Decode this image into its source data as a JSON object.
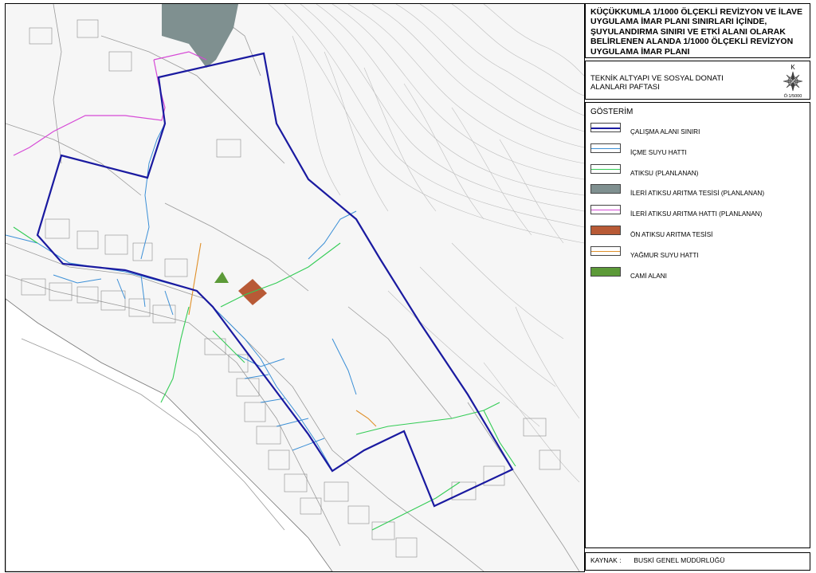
{
  "title": "KÜÇÜKKUMLA 1/1000 ÖLÇEKLİ REVİZYON VE İLAVE UYGULAMA İMAR PLANI SINIRLARI İÇİNDE, ŞUYULANDIRMA SINIRI VE ETKİ ALANI OLARAK BELİRLENEN ALANDA 1/1000 ÖLÇEKLİ REVİZYON UYGULAMA İMAR PLANI",
  "subtitle": "TEKNİK ALTYAPI VE SOSYAL DONATI ALANLARI PAFTASI",
  "compass": {
    "north": "K",
    "scale": "Ö:1/5000",
    "icon": "compass-rose-icon"
  },
  "legend": {
    "title": "GÖSTERİM",
    "items": [
      {
        "label": "ÇALIŞMA ALANI SINIRI",
        "kind": "line",
        "color": "#1a1aa0"
      },
      {
        "label": "İÇME SUYU HATTI",
        "kind": "line",
        "color": "#3b8fd6"
      },
      {
        "label": "ATIKSU (PLANLANAN)",
        "kind": "line",
        "color": "#33cc55"
      },
      {
        "label": "İLERİ ATIKSU ARITMA TESİSİ (PLANLANAN)",
        "kind": "fill",
        "color": "#7f9090"
      },
      {
        "label": "İLERİ ATIKSU ARITMA HATTI (PLANLANAN)",
        "kind": "line",
        "color": "#d64ad6"
      },
      {
        "label": "ÖN ATIKSU ARITMA TESİSİ",
        "kind": "fill",
        "color": "#b85a36"
      },
      {
        "label": "YAĞMUR SUYU HATTI",
        "kind": "line",
        "color": "#e0902a"
      },
      {
        "label": "CAMİ ALANI",
        "kind": "fill",
        "color": "#5c9a38"
      }
    ]
  },
  "source": {
    "label": "KAYNAK :",
    "value": "BUSKİ GENEL MÜDÜRLÜĞÜ"
  }
}
